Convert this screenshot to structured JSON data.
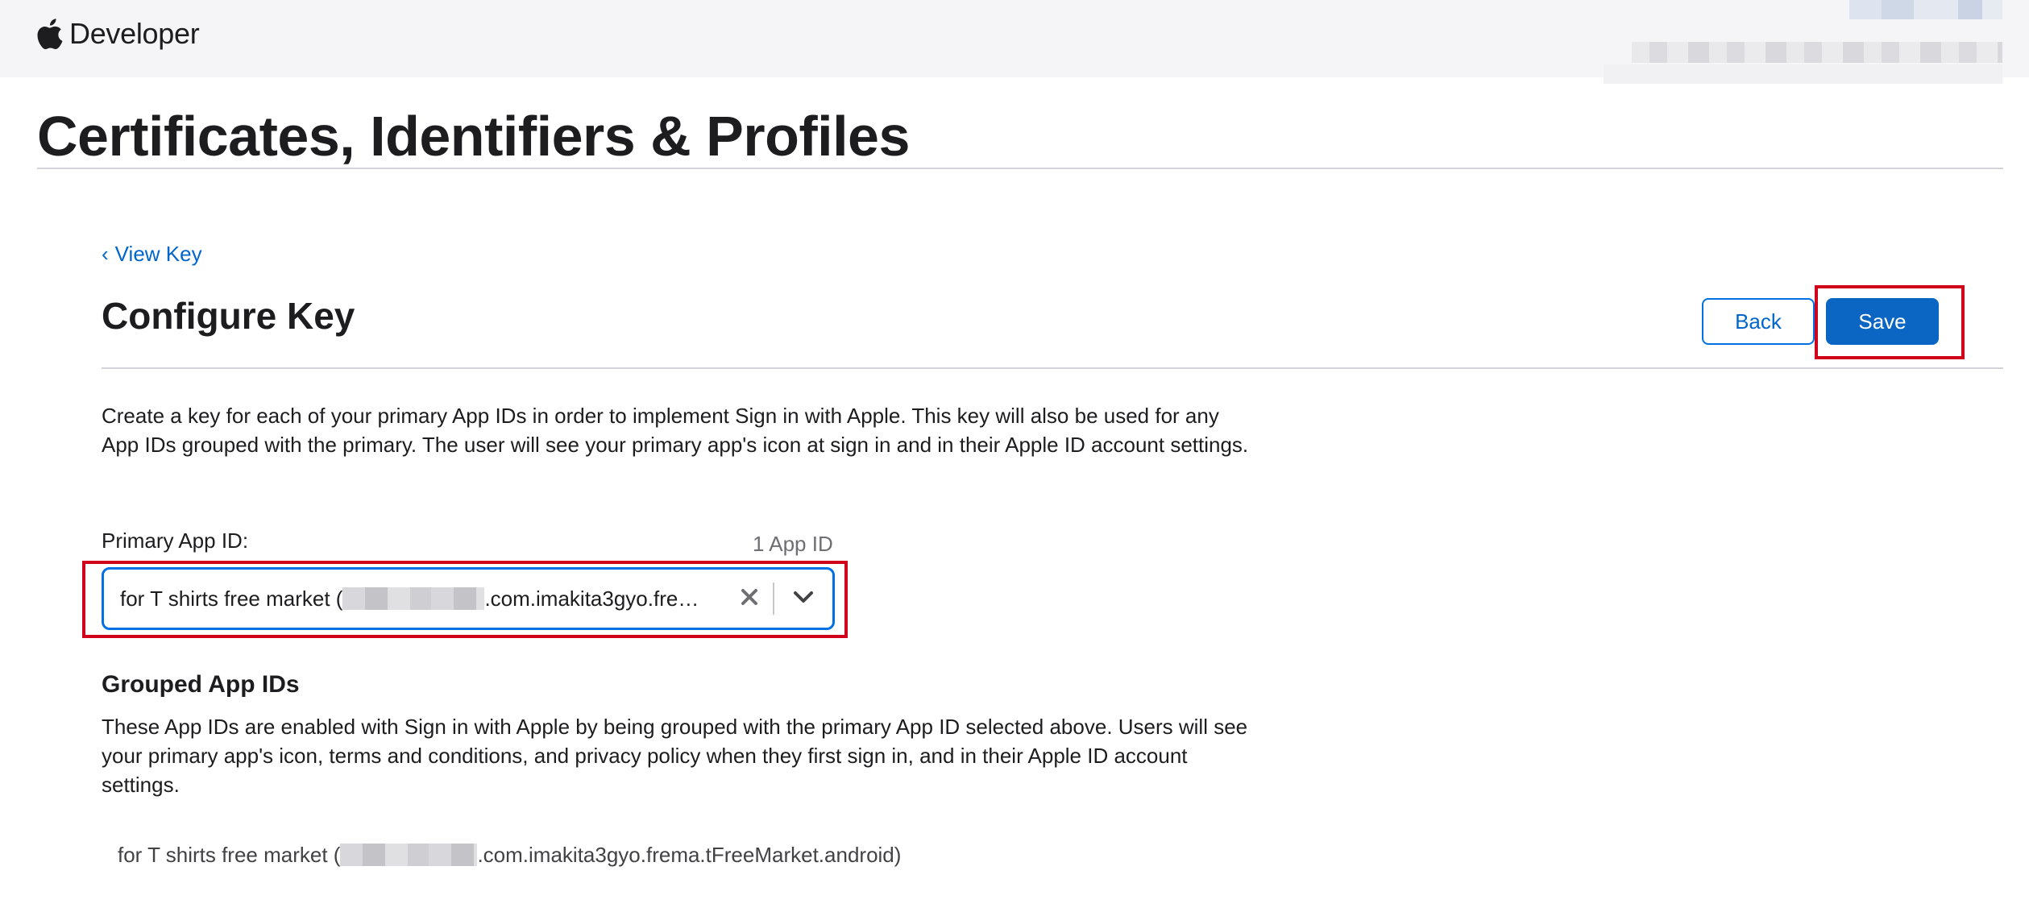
{
  "header": {
    "brand_name": "Developer",
    "brand_icon": "apple-logo-icon"
  },
  "page": {
    "title": "Certificates, Identifiers & Profiles"
  },
  "breadcrumb": {
    "chevron": "‹",
    "label": "View Key"
  },
  "section": {
    "title": "Configure Key",
    "back_label": "Back",
    "save_label": "Save",
    "description": "Create a key for each of your primary App IDs in order to implement Sign in with Apple. This key will also be used for any App IDs grouped with the primary. The user will see your primary app's icon at sign in and in their Apple ID account settings."
  },
  "primary_app_id": {
    "label": "Primary App ID:",
    "count": "1 App ID",
    "selected_prefix": "for T shirts free market (",
    "selected_suffix": ".com.imakita3gyo.fre…",
    "clear_icon": "close-icon",
    "toggle_icon": "chevron-down-icon"
  },
  "grouped": {
    "title": "Grouped App IDs",
    "description": "These App IDs are enabled with Sign in with Apple by being grouped with the primary App ID selected above. Users will see your primary app's icon, terms and conditions, and privacy policy when they first sign in, and in their Apple ID account settings.",
    "items": [
      {
        "prefix": "for T shirts free market (",
        "suffix": ".com.imakita3gyo.frema.tFreeMarket.android)"
      }
    ]
  },
  "colors": {
    "link": "#0066cc",
    "primary_button": "#0a66c2",
    "highlight": "#d0021b",
    "nav_background": "#f5f5f7"
  }
}
